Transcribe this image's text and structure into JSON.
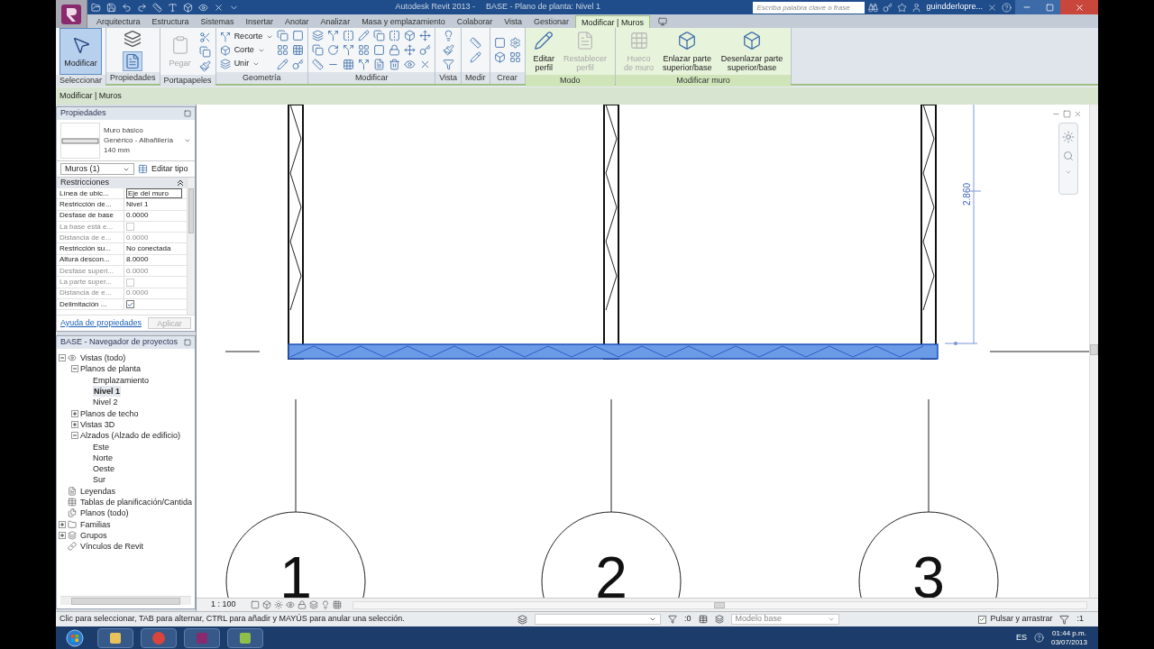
{
  "title_bar": {
    "app_name": "Autodesk Revit 2013 -",
    "document": "BASE - Plano de planta: Nivel 1",
    "search_placeholder": "Escriba palabra clave o frase",
    "user": "guindderlopre..."
  },
  "ribbon_tabs": [
    {
      "label": "Arquitectura",
      "selected": false
    },
    {
      "label": "Estructura",
      "selected": false
    },
    {
      "label": "Sistemas",
      "selected": false
    },
    {
      "label": "Insertar",
      "selected": false
    },
    {
      "label": "Anotar",
      "selected": false
    },
    {
      "label": "Analizar",
      "selected": false
    },
    {
      "label": "Masa y emplazamiento",
      "selected": false
    },
    {
      "label": "Colaborar",
      "selected": false
    },
    {
      "label": "Vista",
      "selected": false
    },
    {
      "label": "Gestionar",
      "selected": false
    },
    {
      "label": "Modificar | Muros",
      "selected": true
    }
  ],
  "ribbon_panels": [
    {
      "kind": "select",
      "label": "Seleccionar",
      "contextual": false,
      "tools": [
        {
          "label": "Modificar",
          "selected": true,
          "disabled": false
        }
      ]
    },
    {
      "kind": "properties",
      "label": "Propiedades",
      "contextual": false
    },
    {
      "kind": "clipboard",
      "label": "Portapapeles",
      "contextual": false,
      "tools": [
        {
          "label": "Pegar",
          "disabled": true
        }
      ]
    },
    {
      "kind": "geometry",
      "label": "Geometría",
      "contextual": false,
      "tools": [
        {
          "label": "Recorte",
          "disabled": false
        },
        {
          "label": "Corte",
          "disabled": false
        },
        {
          "label": "Unir",
          "disabled": false
        }
      ]
    },
    {
      "kind": "modify",
      "label": "Modificar",
      "contextual": false
    },
    {
      "kind": "view",
      "label": "Vista",
      "contextual": false
    },
    {
      "kind": "measure",
      "label": "Medir",
      "contextual": false
    },
    {
      "kind": "create",
      "label": "Crear",
      "contextual": false
    },
    {
      "kind": "mode",
      "label": "Modo",
      "contextual": true,
      "tools": [
        {
          "label": "Editar\nperfil",
          "disabled": false
        },
        {
          "label": "Restablecer\nperfil",
          "disabled": true
        }
      ]
    },
    {
      "kind": "wall",
      "label": "Modificar muro",
      "contextual": true,
      "tools": [
        {
          "label": "Hueco\nde muro",
          "disabled": true
        },
        {
          "label": "Enlazar parte\nsuperior/base",
          "disabled": false
        },
        {
          "label": "Desenlazar parte\nsuperior/base",
          "disabled": false
        }
      ]
    }
  ],
  "options_bar": {
    "context": "Modificar | Muros"
  },
  "properties": {
    "title": "Propiedades",
    "type_lines": [
      "Muro básico",
      "Genérico - Albañilería",
      "140 mm"
    ],
    "selector": "Muros (1)",
    "edit_type": "Editar tipo",
    "group": {
      "label": "Restricciones",
      "expanded": true
    },
    "rows": [
      {
        "kind": "field",
        "name": "Línea de ubic...",
        "value": "Eje del muro",
        "disabled": false
      },
      {
        "kind": "text",
        "name": "Restricción de...",
        "value": "Nivel 1",
        "disabled": false
      },
      {
        "kind": "text",
        "name": "Desfase de base",
        "value": "0.0000",
        "disabled": false
      },
      {
        "kind": "checkbox",
        "name": "La base está e...",
        "checked": false,
        "disabled": true
      },
      {
        "kind": "text",
        "name": "Distancia de e...",
        "value": "0.0000",
        "disabled": true
      },
      {
        "kind": "text",
        "name": "Restricción su...",
        "value": "No conectada",
        "disabled": false
      },
      {
        "kind": "text",
        "name": "Altura descon...",
        "value": "8.0000",
        "disabled": false
      },
      {
        "kind": "text",
        "name": "Desfase superi...",
        "value": "0.0000",
        "disabled": true
      },
      {
        "kind": "checkbox",
        "name": "La parte super...",
        "checked": false,
        "disabled": true
      },
      {
        "kind": "text",
        "name": "Distancia de e...",
        "value": "0.0000",
        "disabled": true
      },
      {
        "kind": "checkbox",
        "name": "Delimitación ...",
        "checked": true,
        "disabled": false
      }
    ],
    "help_link": "Ayuda de propiedades",
    "apply": {
      "label": "Aplicar",
      "disabled": true
    }
  },
  "project_browser": {
    "title": "BASE - Navegador de proyectos",
    "tree": [
      {
        "label": "Vistas (todo)",
        "expanded": true,
        "selected": false,
        "children": [
          {
            "label": "Planos de planta",
            "expanded": true,
            "selected": false,
            "children": [
              {
                "label": "Emplazamiento",
                "selected": false
              },
              {
                "label": "Nivel 1",
                "selected": true
              },
              {
                "label": "Nivel 2",
                "selected": false
              }
            ]
          },
          {
            "label": "Planos de techo",
            "expanded": false,
            "selected": false
          },
          {
            "label": "Vistas 3D",
            "expanded": false,
            "selected": false
          },
          {
            "label": "Alzados (Alzado de edificio)",
            "expanded": true,
            "selected": false,
            "children": [
              {
                "label": "Este",
                "selected": false
              },
              {
                "label": "Norte",
                "selected": false
              },
              {
                "label": "Oeste",
                "selected": false
              },
              {
                "label": "Sur",
                "selected": false
              }
            ]
          }
        ]
      },
      {
        "label": "Leyendas",
        "selected": false
      },
      {
        "label": "Tablas de planificación/Cantida",
        "selected": false
      },
      {
        "label": "Planos (todo)",
        "selected": false
      },
      {
        "label": "Familias",
        "expanded": false,
        "selected": false
      },
      {
        "label": "Grupos",
        "expanded": false,
        "selected": false
      },
      {
        "label": "Vínculos de Revit",
        "selected": false
      }
    ]
  },
  "canvas": {
    "scale": "1 : 100",
    "grid_labels": [
      "1",
      "2",
      "3"
    ],
    "dimension": "2.860"
  },
  "status_bar": {
    "hint": "Clic para seleccionar, TAB para alternar, CTRL para añadir y MAYÚS para anular una selección.",
    "selection_count": ":0",
    "model": "Modelo base",
    "drag": {
      "label": "Pulsar y arrastrar",
      "checked": true
    },
    "filter_count": ":1"
  },
  "taskbar": {
    "language": "ES",
    "time": "01:44 p.m.",
    "date": "03/07/2013"
  }
}
